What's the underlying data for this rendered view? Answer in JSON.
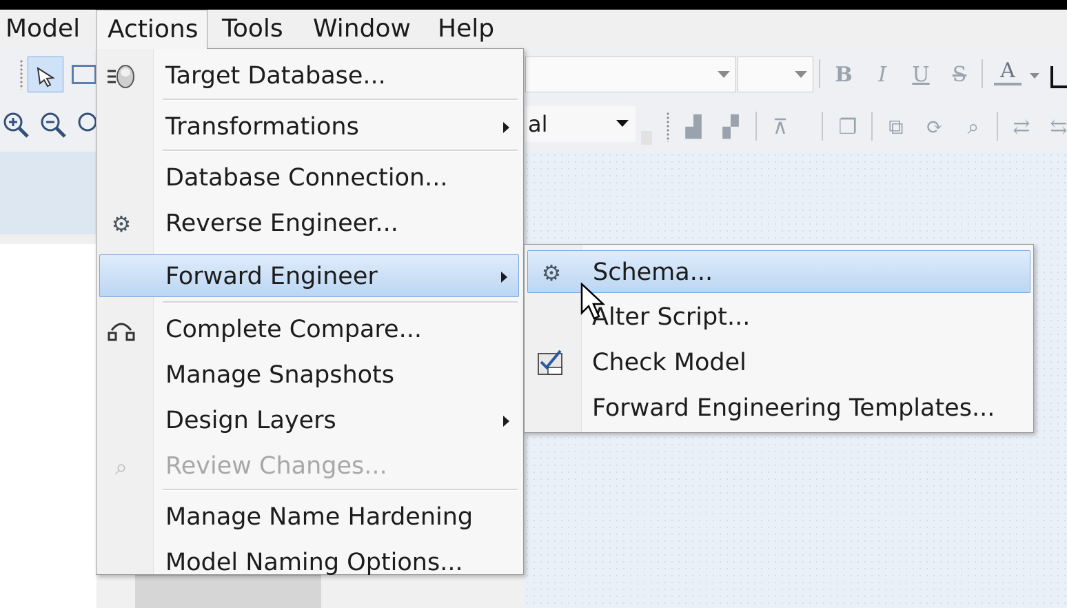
{
  "menubar": {
    "items": [
      {
        "label": "Model"
      },
      {
        "label": "Actions"
      },
      {
        "label": "Tools"
      },
      {
        "label": "Window"
      },
      {
        "label": "Help"
      }
    ]
  },
  "toolbar": {
    "zoom_combo_partial_text": "al",
    "format_buttons": [
      "B",
      "I",
      "U",
      "S",
      "A"
    ]
  },
  "actions_menu": {
    "items": [
      {
        "label": "Target Database...",
        "icon": "target-database-icon"
      },
      {
        "label": "Transformations",
        "submenu": true
      },
      {
        "label": "Database Connection..."
      },
      {
        "label": "Reverse Engineer...",
        "icon": "reverse-engineer-icon"
      },
      {
        "label": "Forward Engineer",
        "submenu": true,
        "highlighted": true
      },
      {
        "label": "Complete Compare...",
        "icon": "complete-compare-icon"
      },
      {
        "label": "Manage Snapshots"
      },
      {
        "label": "Design Layers",
        "submenu": true
      },
      {
        "label": "Review Changes...",
        "icon": "review-changes-icon",
        "disabled": true
      },
      {
        "label": "Manage Name Hardening"
      },
      {
        "label": "Model Naming Options..."
      }
    ]
  },
  "forward_engineer_submenu": {
    "items": [
      {
        "label": "Schema...",
        "icon": "schema-icon",
        "highlighted": true
      },
      {
        "label": "Alter Script..."
      },
      {
        "label": "Check Model",
        "icon": "check-model-icon"
      },
      {
        "label": "Forward Engineering Templates..."
      }
    ]
  },
  "colors": {
    "highlight": "#bcd6f3",
    "highlight_border": "#7aa7dd",
    "menu_bg": "#f7f7f7",
    "disabled_text": "#a8a8a8"
  }
}
